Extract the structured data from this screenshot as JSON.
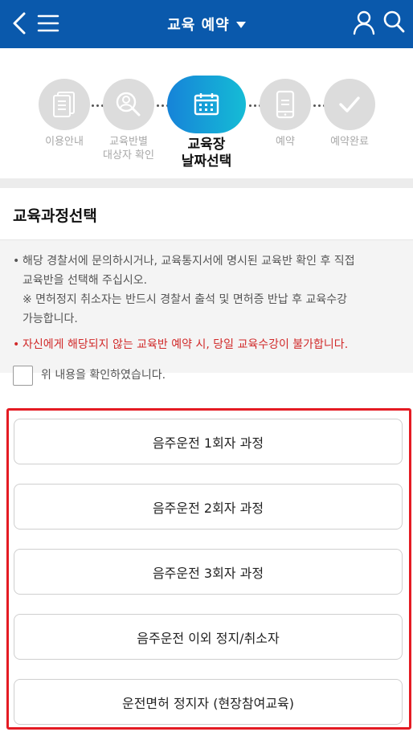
{
  "header": {
    "title": "교육 예약",
    "back_icon": "chevron-left-icon",
    "menu_icon": "hamburger-icon",
    "user_icon": "user-icon",
    "search_icon": "search-icon",
    "bg_color": "#0a59ac"
  },
  "steps": [
    {
      "label": "이용안내",
      "icon": "document-icon",
      "state": "done"
    },
    {
      "label": "교육반별\n대상자 확인",
      "icon": "user-search-icon",
      "state": "done"
    },
    {
      "label": "교육장\n날짜선택",
      "icon": "calendar-icon",
      "state": "current"
    },
    {
      "label": "예약",
      "icon": "phone-icon",
      "state": "todo"
    },
    {
      "label": "예약완료",
      "icon": "check-icon",
      "state": "todo"
    }
  ],
  "section": {
    "title": "교육과정선택",
    "notice_bullet": "해당 경찰서에 문의하시거나, 교육통지서에 명시된 교육반 확인 후 직접",
    "notice_line2": "교육반을 선택해 주십시오.",
    "notice_line3": "※ 면허정지 취소자는 반드시 경찰서 출석 및 면허증 반납 후 교육수강",
    "notice_line4": "가능합니다.",
    "warning": "자신에게 해당되지 않는 교육반 예약 시, 당일 교육수강이 불가합니다.",
    "confirm_label": "위 내용을 확인하였습니다.",
    "confirm_checked": false,
    "warning_color": "#d12a2a"
  },
  "options": [
    "음주운전 1회자 과정",
    "음주운전 2회자 과정",
    "음주운전 3회자 과정",
    "음주운전 이외 정지/취소자",
    "운전면허 정지자 (현장참여교육)"
  ],
  "highlight_color": "#e41b23"
}
